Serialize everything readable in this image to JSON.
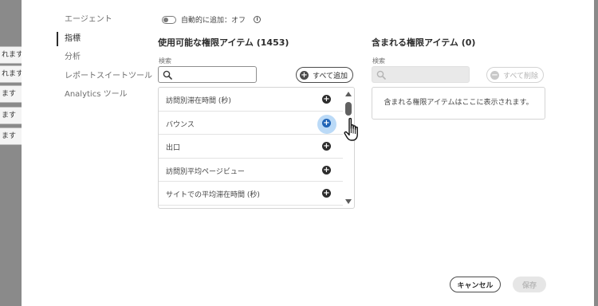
{
  "backdrop": {
    "tabs": [
      "れます",
      "れます",
      "ます",
      "ます",
      "ます"
    ]
  },
  "nav": {
    "items": [
      {
        "label": "エージェント",
        "active": false
      },
      {
        "label": "指標",
        "active": true
      },
      {
        "label": "分析",
        "active": false
      },
      {
        "label": "レポートスイートツール",
        "active": false
      },
      {
        "label": "Analytics ツール",
        "active": false
      }
    ]
  },
  "auto_add": {
    "label": "自動的に追加：オフ",
    "on": false
  },
  "available": {
    "title": "使用可能な権限アイテム (1453)",
    "search_label": "検索",
    "search_placeholder": "",
    "add_all_label": "すべて追加",
    "items": [
      {
        "label": "訪問別滞在時間 (秒)"
      },
      {
        "label": "バウンス"
      },
      {
        "label": "出口"
      },
      {
        "label": "訪問別平均ページビュー"
      },
      {
        "label": "サイトでの平均滞在時間 (秒)"
      }
    ]
  },
  "included": {
    "title": "含まれる権限アイテム (0)",
    "search_label": "検索",
    "search_placeholder": "",
    "remove_all_label": "すべて削除",
    "empty_message": "含まれる権限アイテムはここに表示されます。"
  },
  "footer": {
    "cancel_label": "キャンセル",
    "save_label": "保存"
  },
  "colors": {
    "accent_hover": "#1e63b6",
    "halo": "#84bcf0",
    "text": "#2c2c2c",
    "backdrop": "#8a8a8a"
  }
}
